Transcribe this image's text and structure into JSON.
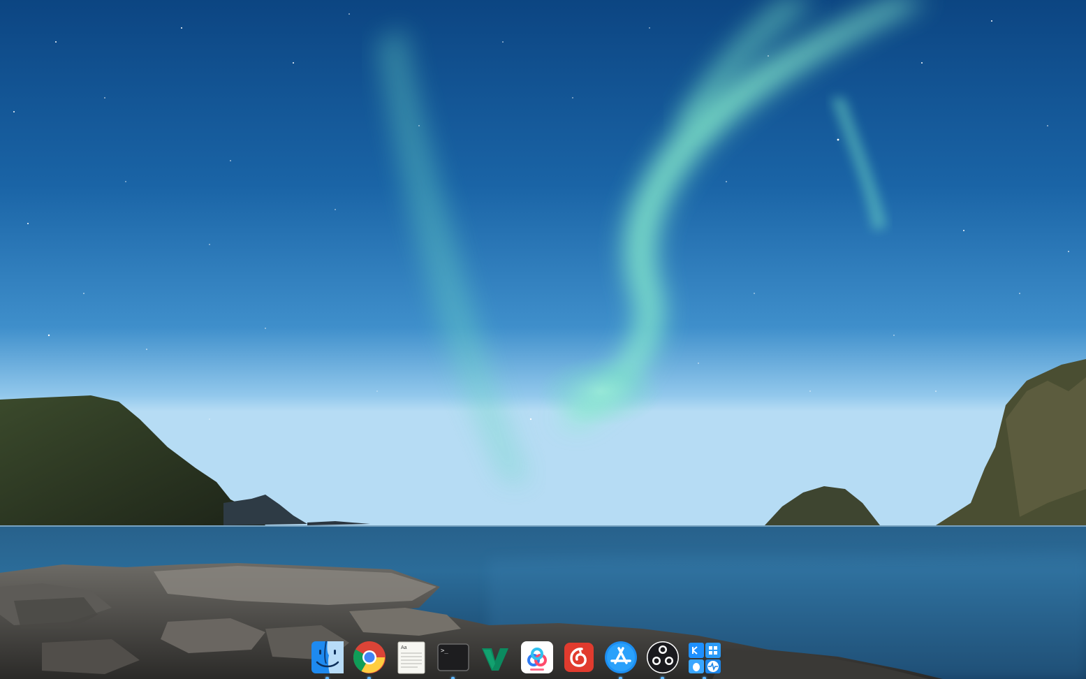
{
  "desktop": {
    "wallpaper": "aurora-over-coastal-bay",
    "colors": {
      "sky_top": "#0f4a86",
      "aurora": "#7ff2c8",
      "sea": "#1f5a85",
      "indicator": "#5fb7ff"
    }
  },
  "dock": {
    "items": [
      {
        "id": "finder",
        "icon": "finder-icon",
        "running": true
      },
      {
        "id": "chrome",
        "icon": "chrome-icon",
        "running": true
      },
      {
        "id": "textedit",
        "icon": "textedit-icon",
        "label": "Aa",
        "running": false
      },
      {
        "id": "terminal",
        "icon": "terminal-icon",
        "label": ">_",
        "running": true
      },
      {
        "id": "vim",
        "icon": "vim-icon",
        "label": "V",
        "running": false
      },
      {
        "id": "cloud-drive",
        "icon": "cloud-drive-icon",
        "running": false
      },
      {
        "id": "netease-music",
        "icon": "netease-music-icon",
        "running": false
      },
      {
        "id": "app-store",
        "icon": "app-store-icon",
        "running": true
      },
      {
        "id": "obs",
        "icon": "obs-icon",
        "running": true
      },
      {
        "id": "system-monitor",
        "icon": "system-monitor-icon",
        "running": true
      }
    ]
  }
}
